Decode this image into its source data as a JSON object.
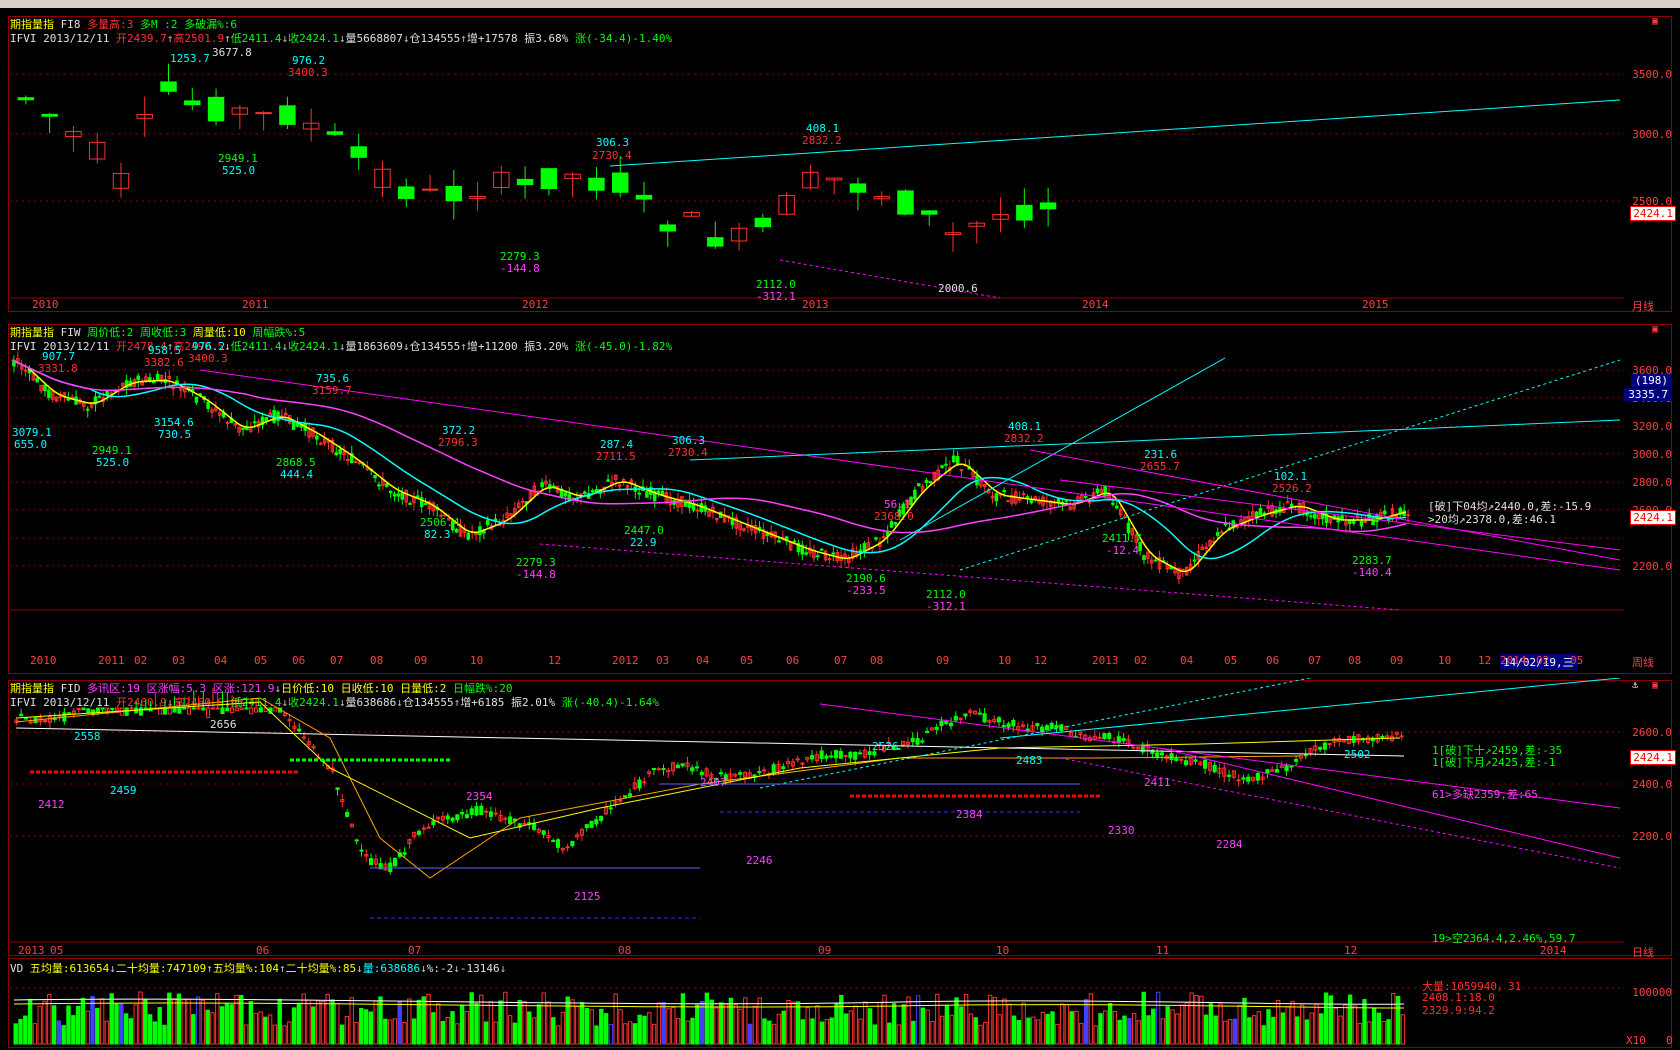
{
  "top_strip": {
    "bg": "#d4d0c8"
  },
  "monthly": {
    "title": "期指量指",
    "code": "FI8",
    "ind1": "多量高:3",
    "ind2": "多M",
    "ind3": ":2",
    "ind4": "多破漏%:6",
    "quote": {
      "sym": "IFVI",
      "date": "2013/12/11",
      "open": "开2439.7",
      "high": "高2501.9",
      "low": "低2411.4",
      "close": "收2424.1",
      "vol": "量5668807",
      "pos": "仓134555",
      "inc": "增+17578",
      "amp": "振3.68%",
      "chg": "涨(-34.4)-1.40%"
    },
    "yticks": [
      "3500.0",
      "3000.0",
      "2500.0"
    ],
    "last": "2424.1",
    "period": "月线",
    "xlabels": [
      "2010",
      "2011",
      "2012",
      "2013",
      "2014",
      "2015"
    ],
    "labels": [
      "1253.7",
      "3677.8",
      "976.2",
      "3400.3",
      "2949.1",
      "525.0",
      "306.3",
      "2730.4",
      "408.1",
      "2832.2",
      "2279.3",
      "-144.8",
      "2112.0",
      "-312.1",
      "2000.6"
    ]
  },
  "weekly": {
    "title": "期指量指",
    "code": "FIW",
    "ind1": "周价低:2",
    "ind2": "周收低:3",
    "ind3": "周量低:10",
    "ind4": "周幅跌%:5",
    "quote": {
      "sym": "IFVI",
      "date": "2013/12/11",
      "open": "开2478.4",
      "high": "高2490.5",
      "low": "低2411.4",
      "close": "收2424.1",
      "vol": "量1863609",
      "pos": "仓134555",
      "inc": "增+11200",
      "amp": "振3.20%",
      "chg": "涨(-45.0)-1.82%"
    },
    "yticks": [
      "3600.0",
      "3400.0",
      "3200.0",
      "3000.0",
      "2800.0",
      "2600.0",
      "2400.0",
      "2200.0"
    ],
    "last": "2424.1",
    "badge1": "(198)",
    "badge2": "3335.7",
    "period": "周线",
    "xlabels": [
      "2010",
      "2011",
      "02",
      "03",
      "04",
      "05",
      "06",
      "07",
      "08",
      "09",
      "10",
      "12",
      "2012",
      "03",
      "04",
      "05",
      "06",
      "07",
      "08",
      "09",
      "10",
      "12",
      "2013",
      "02",
      "04",
      "05",
      "06",
      "07",
      "08",
      "09",
      "10",
      "12",
      "2014",
      "02",
      "05"
    ],
    "cursor_date": "14/02/19,三",
    "note1": "[破]下04均↗2440.0,差:-15.9",
    "note2": ">20均↗2378.0,差:46.1",
    "labels": [
      "907.7",
      "3331.8",
      "958.5",
      "3382.6",
      "976.2",
      "3400.3",
      "735.6",
      "3159.7",
      "3079.1",
      "655.0",
      "3154.6",
      "730.5",
      "2949.1",
      "525.0",
      "2868.5",
      "444.4",
      "372.2",
      "2796.3",
      "287.4",
      "2711.5",
      "306.3",
      "2730.4",
      "2506.4",
      "82.3",
      "2447.0",
      "22.9",
      "2279.3",
      "-144.8",
      "56.1",
      "2368.0",
      "2190.6",
      "-233.5",
      "2112.0",
      "-312.1",
      "408.1",
      "2832.2",
      "231.6",
      "2655.7",
      "2411.7",
      "-12.4",
      "102.1",
      "2526.2",
      "2283.7",
      "-140.4"
    ]
  },
  "daily": {
    "title": "期指量指",
    "code": "FID",
    "ind1": "多讯区:19",
    "ind2": "区涨幅:5.3",
    "ind3": "区涨:121.9",
    "ind4": "日价低:10",
    "ind5": "日收低:10",
    "ind6": "日量低:2",
    "ind7": "日幅跌%:20",
    "quote": {
      "sym": "IFVI",
      "date": "2013/12/11",
      "open": "开2460.9",
      "high": "高2460.9",
      "low": "低2411.4",
      "close": "收2424.1",
      "vol": "量638686",
      "pos": "仓134555",
      "inc": "增+6185",
      "amp": "振2.01%",
      "chg": "涨(-40.4)-1.64%"
    },
    "yticks": [
      "2600.0",
      "2400.0",
      "2200.0"
    ],
    "last": "2424.1",
    "period": "日线",
    "xlabels": [
      "2013",
      "05",
      "06",
      "07",
      "08",
      "09",
      "10",
      "11",
      "12",
      "2014"
    ],
    "note1": "1[破]下十↗2459,差:-35",
    "note2": "1[破]下月↗2425,差:-1",
    "note3": "61>多缺2359,差:65",
    "note4": "19>空2364.4,2.46%,59.7",
    "labels": [
      "2558",
      "2412",
      "2459",
      "2656",
      "2354",
      "2125",
      "2407",
      "2246",
      "2526",
      "2384",
      "2483",
      "2330",
      "2411",
      "2284",
      "2502"
    ]
  },
  "volume": {
    "title": "VD",
    "ma5": "五均量:613654",
    "ma20": "二十均量:747109",
    "ratio5": "五均量%:104",
    "ratio20": "二十均量%:85",
    "vol": "量:638686",
    "pct": "%:-2",
    "diff": "-13146",
    "big": "大量:1059940，31",
    "v1": "2408.1:18.0",
    "v2": "2329.9:94.2",
    "ytick": "100000",
    "x10": "X10",
    "zero": "0"
  },
  "colors": {
    "up": "#ff3030",
    "down": "#00ff00",
    "frame": "#8b0000",
    "cyan": "#00ffff",
    "magenta": "#ff00ff",
    "yellow": "#ffff00",
    "bg": "#000000"
  }
}
